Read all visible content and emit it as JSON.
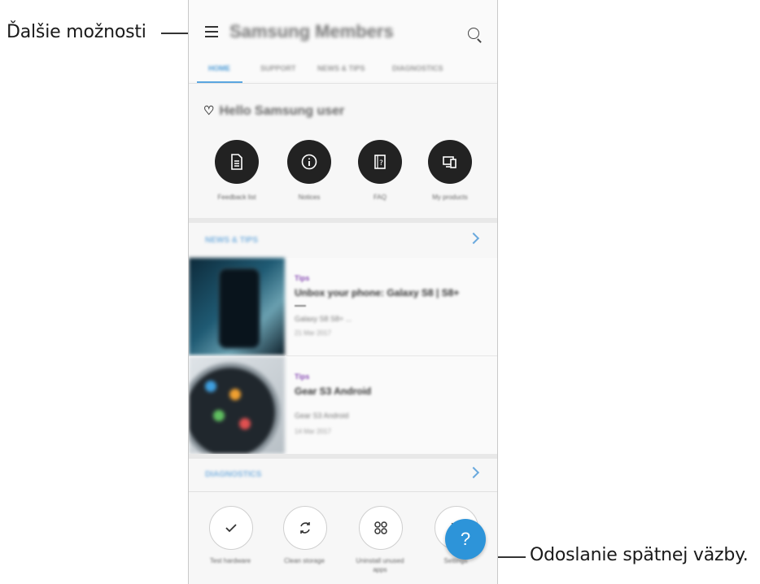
{
  "callouts": {
    "more_options": "Ďalšie možnosti",
    "send_feedback": "Odoslanie spätnej väzby."
  },
  "app": {
    "title": "Samsung Members",
    "menu_icon": "hamburger-icon",
    "search_icon": "search-icon"
  },
  "tabs": [
    {
      "label": "HOME",
      "active": true
    },
    {
      "label": "SUPPORT",
      "active": false
    },
    {
      "label": "NEWS & TIPS",
      "active": false
    },
    {
      "label": "DIAGNOSTICS",
      "active": false
    }
  ],
  "hello": {
    "text": "Hello Samsung user",
    "icon": "heart-icon"
  },
  "quick_actions": [
    {
      "label": "Feedback list",
      "icon": "document-icon"
    },
    {
      "label": "Notices",
      "icon": "info-icon"
    },
    {
      "label": "FAQ",
      "icon": "faq-book-icon"
    },
    {
      "label": "My products",
      "icon": "devices-icon"
    }
  ],
  "news_section": {
    "title": "NEWS & TIPS"
  },
  "news": [
    {
      "tag": "Tips",
      "title": "Unbox your phone: Galaxy S8 | S8+",
      "desc": "Galaxy S8 S8+ ...",
      "date": "21 Mar 2017",
      "image": "phone-photo"
    },
    {
      "tag": "Tips",
      "title": "Gear S3 Android",
      "desc": "Gear S3 Android",
      "date": "14 Mar 2017",
      "image": "watch-photo"
    }
  ],
  "diagnostics_section": {
    "title": "DIAGNOSTICS"
  },
  "diagnostics": [
    {
      "label": "Test hardware",
      "icon": "check-icon"
    },
    {
      "label": "Clean storage",
      "icon": "refresh-icon"
    },
    {
      "label": "Uninstall unused apps",
      "icon": "apps-grid-icon"
    },
    {
      "label": "Settings",
      "icon": "gear-icon"
    }
  ],
  "fab": {
    "label": "?",
    "icon": "help-icon"
  },
  "colors": {
    "accent": "#2d94d9",
    "tab_active": "#4d9bd6",
    "tag": "#8a4fb5"
  }
}
